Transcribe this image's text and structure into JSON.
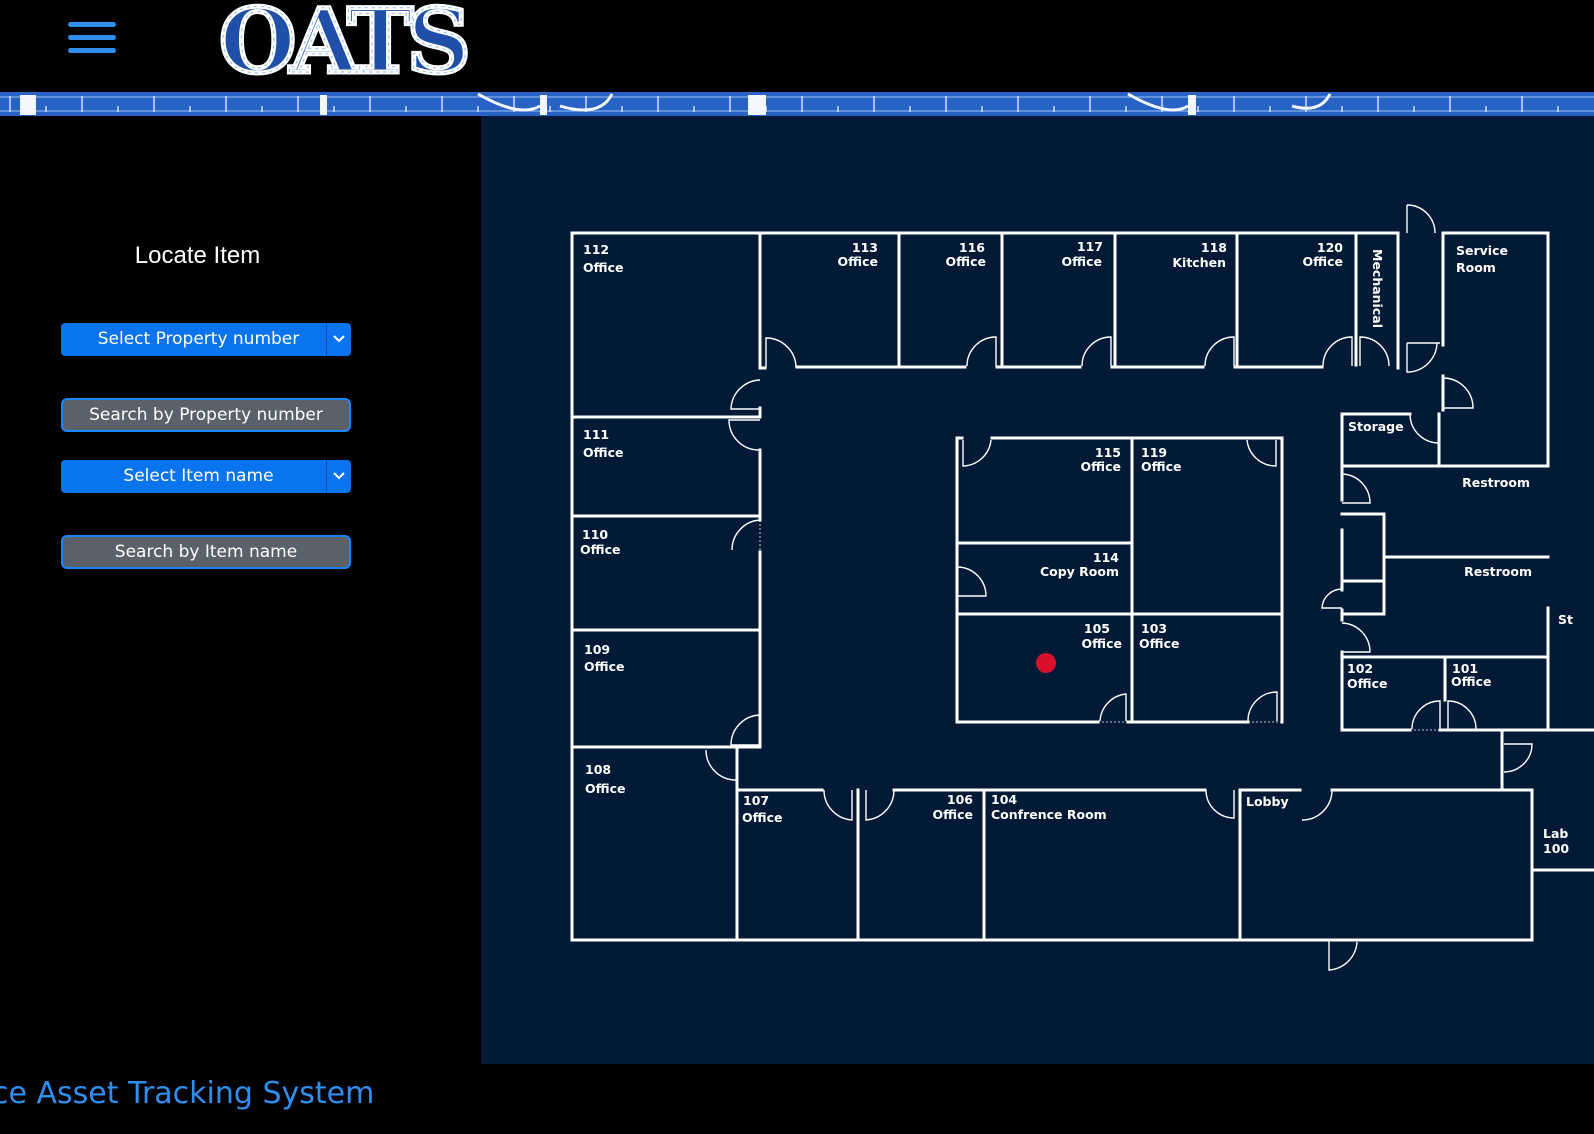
{
  "header": {
    "menu_icon": "hamburger-menu-icon",
    "logo_text": "OATS",
    "accent_color": "#2f8ff0"
  },
  "sidebar": {
    "title": "Locate Item",
    "select_property": "Select Property number",
    "search_property": "Search by Property number",
    "select_item": "Select Item name",
    "search_item": "Search by Item name"
  },
  "floorplan": {
    "rooms": {
      "r112": [
        "112",
        "Office"
      ],
      "r113": [
        "113",
        "Office"
      ],
      "r116": [
        "116",
        "Office"
      ],
      "r117": [
        "117",
        "Office"
      ],
      "r118": [
        "118",
        "Kitchen"
      ],
      "r120": [
        "120",
        "Office"
      ],
      "mechanical": "Mechanical",
      "service": [
        "Service",
        "Room"
      ],
      "r111": [
        "111",
        "Office"
      ],
      "r110": [
        "110",
        "Office"
      ],
      "r109": [
        "109",
        "Office"
      ],
      "r108": [
        "108",
        "Office"
      ],
      "r115": [
        "115",
        "Office"
      ],
      "r119": [
        "119",
        "Office"
      ],
      "r114": [
        "114",
        "Copy Room"
      ],
      "r105": [
        "105",
        "Office"
      ],
      "r103": [
        "103",
        "Office"
      ],
      "storage": "Storage",
      "restroom1": "Restroom",
      "restroom2": "Restroom",
      "r102": [
        "102",
        "Office"
      ],
      "r101": [
        "101",
        "Office"
      ],
      "r107": [
        "107",
        "Office"
      ],
      "r106": [
        "106",
        "Office"
      ],
      "r104": [
        "104",
        "Confrence Room"
      ],
      "lobby": "Lobby",
      "lab": [
        "Lab",
        "100"
      ],
      "cut_label": "St"
    },
    "item_marker_room": "105",
    "marker_color": "#d8102c"
  },
  "footer": {
    "text": "ce Asset Tracking System"
  }
}
